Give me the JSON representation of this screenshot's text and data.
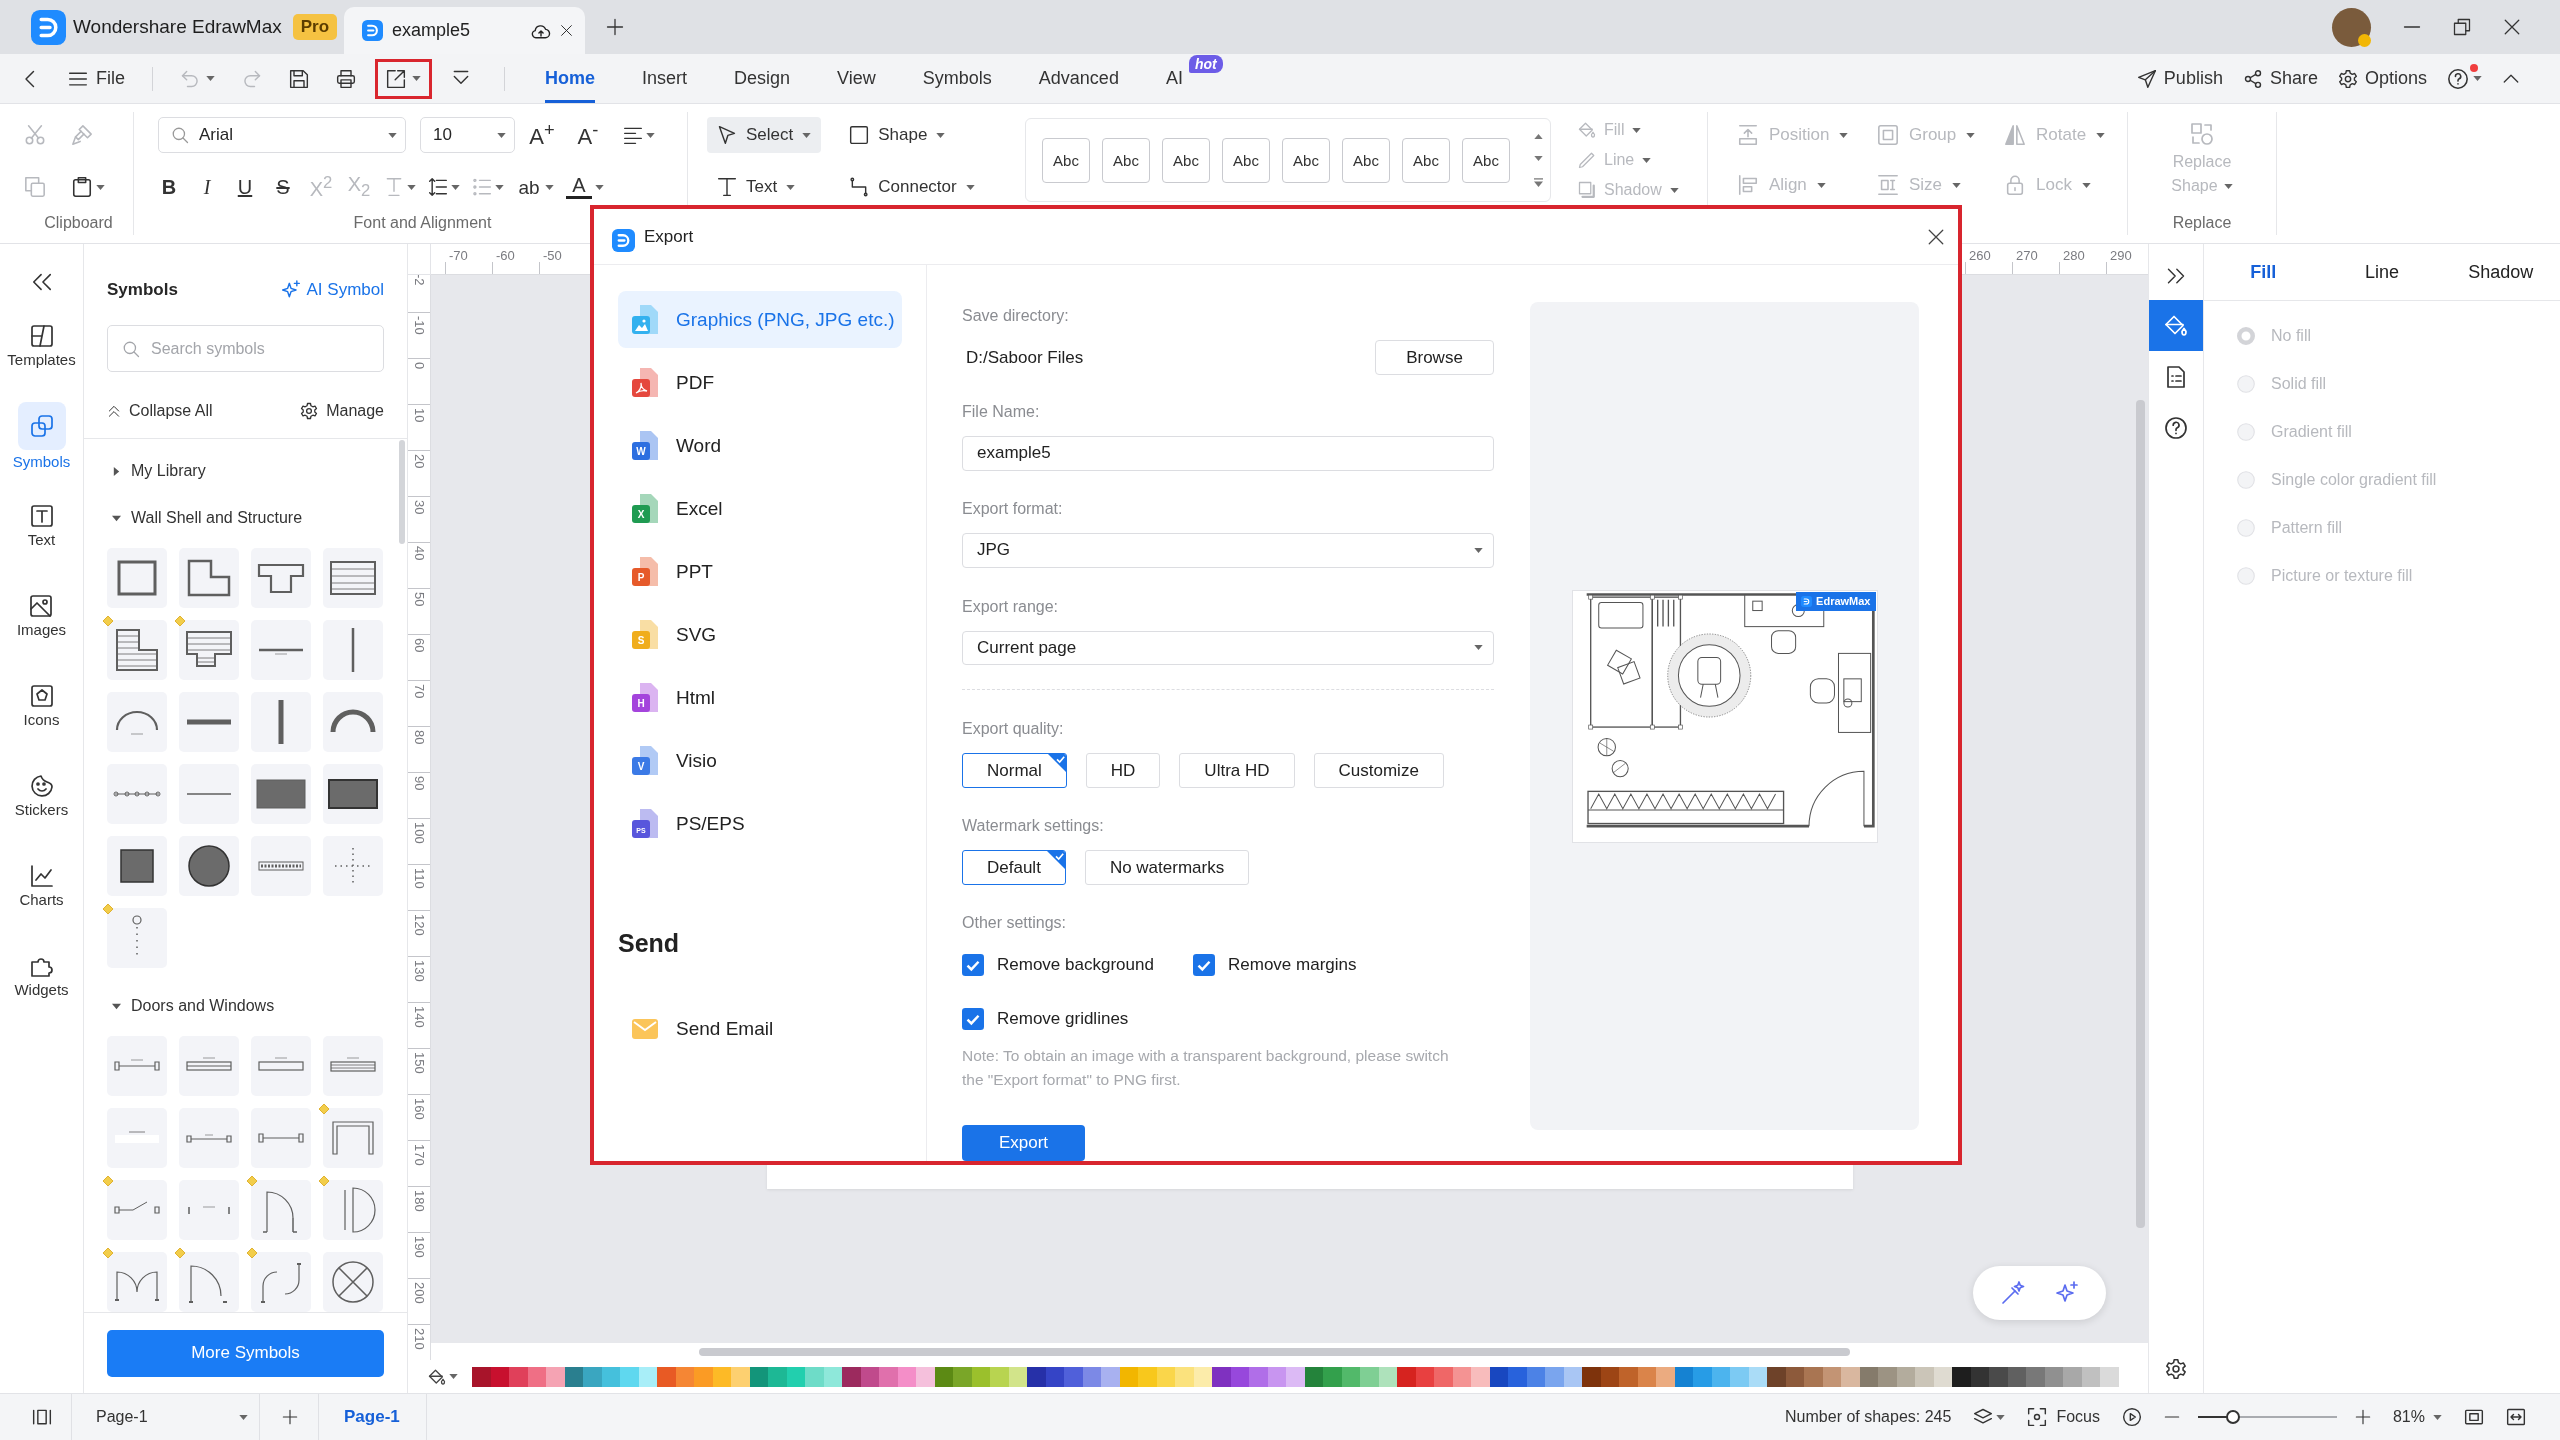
{
  "title_bar": {
    "app_tab": {
      "title": "Wondershare EdrawMax",
      "badge": "Pro"
    },
    "doc_tab": {
      "title": "example5"
    }
  },
  "toolbar": {
    "file": "File",
    "quick_access": [
      {
        "kind": "undo",
        "disabled": true,
        "highlighted": false
      },
      {
        "kind": "redo",
        "disabled": true,
        "highlighted": false
      },
      {
        "kind": "save",
        "disabled": false,
        "highlighted": false
      },
      {
        "kind": "print",
        "disabled": false,
        "highlighted": false
      },
      {
        "kind": "export",
        "disabled": false,
        "highlighted": true
      },
      {
        "kind": "more",
        "disabled": false,
        "highlighted": false
      }
    ],
    "tabs": [
      {
        "label": "Home",
        "selected": true
      },
      {
        "label": "Insert",
        "selected": false
      },
      {
        "label": "Design",
        "selected": false
      },
      {
        "label": "View",
        "selected": false
      },
      {
        "label": "Symbols",
        "selected": false
      },
      {
        "label": "Advanced",
        "selected": false
      },
      {
        "label": "AI",
        "selected": false,
        "badge": "hot"
      }
    ],
    "actions": [
      {
        "kind": "publish",
        "label": "Publish"
      },
      {
        "kind": "share",
        "label": "Share"
      },
      {
        "kind": "options",
        "label": "Options"
      }
    ],
    "help_notice": true
  },
  "ribbon": {
    "clipboard": {
      "label": "Clipboard",
      "buttons": [
        {
          "kind": "cut",
          "disabled": true
        },
        {
          "kind": "format-painter",
          "disabled": true
        },
        {
          "kind": "copy",
          "disabled": true
        },
        {
          "kind": "paste",
          "disabled": false
        }
      ]
    },
    "font": {
      "family": "Arial",
      "size": "10",
      "grow": "A$^{+}$",
      "shrink": "A$^{-}$",
      "buttons": [
        {
          "kind": "bold",
          "glyph": "B",
          "disabled": false
        },
        {
          "kind": "italic",
          "glyph": "I",
          "disabled": false
        },
        {
          "kind": "underline",
          "glyph": "U",
          "disabled": false
        },
        {
          "kind": "strike",
          "glyph": "S",
          "disabled": false
        },
        {
          "kind": "superscript",
          "glyph": "X$^{2}$",
          "disabled": true
        },
        {
          "kind": "subscript",
          "glyph": "X$_{2}$",
          "disabled": true
        },
        {
          "kind": "text-style",
          "disabled": true
        },
        {
          "kind": "line-spacing",
          "disabled": false
        },
        {
          "kind": "bullets",
          "disabled": true
        },
        {
          "kind": "highlight",
          "glyph": "ab",
          "disabled": false
        },
        {
          "kind": "font-color",
          "glyph": "A",
          "disabled": false
        }
      ],
      "label": "Font and Alignment"
    },
    "tools": [
      {
        "kind": "select",
        "label": "Select",
        "selected": true
      },
      {
        "kind": "shape",
        "label": "Shape",
        "selected": false
      },
      {
        "kind": "text",
        "label": "Text",
        "selected": false
      },
      {
        "kind": "connector",
        "label": "Connector",
        "selected": false
      }
    ],
    "styles": [
      "Abc",
      "Abc",
      "Abc",
      "Abc",
      "Abc",
      "Abc",
      "Abc",
      "Abc"
    ],
    "format": [
      {
        "kind": "fill",
        "label": "Fill",
        "disabled": true
      },
      {
        "kind": "line",
        "label": "Line",
        "disabled": true
      },
      {
        "kind": "shadow",
        "label": "Shadow",
        "disabled": true
      }
    ],
    "arrange": [
      {
        "kind": "position",
        "label": "Position",
        "disabled": true
      },
      {
        "kind": "group",
        "label": "Group",
        "disabled": true
      },
      {
        "kind": "rotate",
        "label": "Rotate",
        "disabled": true
      },
      {
        "kind": "align",
        "label": "Align",
        "disabled": true
      },
      {
        "kind": "size",
        "label": "Size",
        "disabled": true
      },
      {
        "kind": "lock",
        "label": "Lock",
        "disabled": true
      }
    ],
    "replace": {
      "button": "Replace Shape",
      "label": "Replace",
      "disabled": true
    }
  },
  "left_rail": [
    {
      "kind": "templates",
      "label": "Templates",
      "selected": false
    },
    {
      "kind": "symbols",
      "label": "Symbols",
      "selected": true
    },
    {
      "kind": "text",
      "label": "Text",
      "selected": false
    },
    {
      "kind": "images",
      "label": "Images",
      "selected": false
    },
    {
      "kind": "icons",
      "label": "Icons",
      "selected": false
    },
    {
      "kind": "stickers",
      "label": "Stickers",
      "selected": false
    },
    {
      "kind": "charts",
      "label": "Charts",
      "selected": false
    },
    {
      "kind": "widgets",
      "label": "Widgets",
      "selected": false
    }
  ],
  "symbols_panel": {
    "title": "Symbols",
    "ai_link": "AI Symbol",
    "search_placeholder": "Search symbols",
    "collapse_all": "Collapse All",
    "manage": "Manage",
    "sections": [
      {
        "title": "My Library",
        "expanded": false
      },
      {
        "title": "Wall Shell and Structure",
        "expanded": true,
        "tiles": [
          {
            "kind": "room-square",
            "premium": false
          },
          {
            "kind": "room-l",
            "premium": false
          },
          {
            "kind": "room-t",
            "premium": false
          },
          {
            "kind": "room-striped",
            "premium": false
          },
          {
            "kind": "room-striped-l",
            "premium": true
          },
          {
            "kind": "room-striped-step",
            "premium": true
          },
          {
            "kind": "wall-thin-h",
            "premium": false
          },
          {
            "kind": "wall-thin-v",
            "premium": false
          },
          {
            "kind": "wall-arc-thin",
            "premium": false
          },
          {
            "kind": "wall-thick-h",
            "premium": false
          },
          {
            "kind": "wall-thick-v",
            "premium": false
          },
          {
            "kind": "wall-arc-thick",
            "premium": false
          },
          {
            "kind": "wall-points",
            "premium": false
          },
          {
            "kind": "wall-line",
            "premium": false
          },
          {
            "kind": "wall-block",
            "premium": false
          },
          {
            "kind": "wall-block-framed",
            "premium": false
          },
          {
            "kind": "column-square",
            "premium": false
          },
          {
            "kind": "column-round",
            "premium": false
          },
          {
            "kind": "wall-hatched",
            "premium": false
          },
          {
            "kind": "wall-cross",
            "premium": false
          },
          {
            "kind": "wall-pin",
            "premium": true
          }
        ]
      },
      {
        "title": "Doors and Windows",
        "expanded": true,
        "tiles": [
          {
            "kind": "window-bracket",
            "premium": false
          },
          {
            "kind": "window-double",
            "premium": false
          },
          {
            "kind": "window-single",
            "premium": false
          },
          {
            "kind": "window-triple",
            "premium": false
          },
          {
            "kind": "window-plain",
            "premium": false
          },
          {
            "kind": "window-small",
            "premium": false
          },
          {
            "kind": "window-bracket-b",
            "premium": false
          },
          {
            "kind": "opening-frame",
            "premium": true
          },
          {
            "kind": "sliding-window",
            "premium": true
          },
          {
            "kind": "window-gap",
            "premium": false
          },
          {
            "kind": "door-single",
            "premium": true
          },
          {
            "kind": "door-round",
            "premium": true
          },
          {
            "kind": "door-double",
            "premium": true
          },
          {
            "kind": "door-single-b",
            "premium": true
          },
          {
            "kind": "door-folding",
            "premium": true
          },
          {
            "kind": "column-cross",
            "premium": false
          }
        ]
      }
    ],
    "more_button": "More Symbols"
  },
  "rulers": {
    "horizontal_start": [
      "-70",
      "-60",
      "-50"
    ],
    "horizontal_end": [
      "260",
      "270",
      "280",
      "290"
    ],
    "vertical": [
      "-2",
      "-10",
      "0",
      "10",
      "20",
      "30",
      "40",
      "50",
      "60",
      "70",
      "80",
      "90",
      "100",
      "110",
      "120",
      "130",
      "140",
      "150",
      "160",
      "170",
      "180",
      "190",
      "200",
      "210"
    ]
  },
  "palette": {
    "swatches": [
      {
        "color": "#a8142a"
      },
      {
        "color": "#c8102e"
      },
      {
        "color": "#e0405a"
      },
      {
        "color": "#ef6f85"
      },
      {
        "color": "#f5a3b3"
      },
      {
        "color": "#2a7f8f"
      },
      {
        "color": "#3aa6c0"
      },
      {
        "color": "#45c0dc"
      },
      {
        "color": "#5fd8ef"
      },
      {
        "color": "#a8eef8"
      },
      {
        "color": "#e85a24"
      },
      {
        "color": "#f58634"
      },
      {
        "color": "#fb9b24"
      },
      {
        "color": "#fdba26"
      },
      {
        "color": "#fdd070"
      },
      {
        "color": "#13957a"
      },
      {
        "color": "#1db895"
      },
      {
        "color": "#22cfae"
      },
      {
        "color": "#6edcc8"
      },
      {
        "color": "#8ee8da"
      },
      {
        "color": "#9c2a5e"
      },
      {
        "color": "#c04a8c"
      },
      {
        "color": "#e070ac"
      },
      {
        "color": "#f48ec8"
      },
      {
        "color": "#f5c0dc"
      },
      {
        "color": "#5c8a14"
      },
      {
        "color": "#7aa628"
      },
      {
        "color": "#9bc02c"
      },
      {
        "color": "#b8d450"
      },
      {
        "color": "#d2e48a"
      },
      {
        "color": "#2630a8"
      },
      {
        "color": "#3544c6"
      },
      {
        "color": "#5060da"
      },
      {
        "color": "#7c89e6"
      },
      {
        "color": "#a8b1f0"
      },
      {
        "color": "#f2b600"
      },
      {
        "color": "#f8c81c"
      },
      {
        "color": "#fad64a"
      },
      {
        "color": "#fbe27d"
      },
      {
        "color": "#fcecaa"
      },
      {
        "color": "#7f31c0"
      },
      {
        "color": "#9748dc"
      },
      {
        "color": "#b06ee8"
      },
      {
        "color": "#c895f0"
      },
      {
        "color": "#dcbaf5"
      },
      {
        "color": "#24833b"
      },
      {
        "color": "#33a04c"
      },
      {
        "color": "#52b96a"
      },
      {
        "color": "#7fcf94"
      },
      {
        "color": "#aee2bb"
      },
      {
        "color": "#d6231f"
      },
      {
        "color": "#e84040"
      },
      {
        "color": "#ef6767"
      },
      {
        "color": "#f49393"
      },
      {
        "color": "#f8bcbc"
      },
      {
        "color": "#1847c0"
      },
      {
        "color": "#2862dc"
      },
      {
        "color": "#4c82e6"
      },
      {
        "color": "#7aa5ee"
      },
      {
        "color": "#a9c6f4"
      },
      {
        "color": "#7e330c"
      },
      {
        "color": "#9d4515"
      },
      {
        "color": "#bf632a"
      },
      {
        "color": "#da844a"
      },
      {
        "color": "#ebab80"
      },
      {
        "color": "#1582d2"
      },
      {
        "color": "#279ce6"
      },
      {
        "color": "#4cb4ee"
      },
      {
        "color": "#7ccaf3"
      },
      {
        "color": "#aadcf7"
      },
      {
        "color": "#6e4229"
      },
      {
        "color": "#8d5a3b"
      },
      {
        "color": "#a97552"
      },
      {
        "color": "#c39474"
      },
      {
        "color": "#d9b79f"
      },
      {
        "color": "#857b6b"
      },
      {
        "color": "#9c9383"
      },
      {
        "color": "#b3ac9d"
      },
      {
        "color": "#cbc5b8"
      },
      {
        "color": "#dfdbd1"
      },
      {
        "color": "#1e1e1e"
      },
      {
        "color": "#333333"
      },
      {
        "color": "#4a4a4a"
      },
      {
        "color": "#606060"
      },
      {
        "color": "#787878"
      },
      {
        "color": "#909090"
      },
      {
        "color": "#a8a8a8"
      },
      {
        "color": "#c0c0c0"
      },
      {
        "color": "#dadada"
      }
    ]
  },
  "format_panel": {
    "rail": [
      {
        "kind": "fill",
        "selected": true
      },
      {
        "kind": "page",
        "selected": false
      },
      {
        "kind": "help",
        "selected": false
      }
    ],
    "tabs": [
      {
        "label": "Fill",
        "selected": true
      },
      {
        "label": "Line",
        "selected": false
      },
      {
        "label": "Shadow",
        "selected": false
      }
    ],
    "fill_options": [
      {
        "label": "No fill",
        "selected": true,
        "disabled": true
      },
      {
        "label": "Solid fill",
        "selected": false,
        "disabled": true
      },
      {
        "label": "Gradient fill",
        "selected": false,
        "disabled": true
      },
      {
        "label": "Single color gradient fill",
        "selected": false,
        "disabled": true
      },
      {
        "label": "Pattern fill",
        "selected": false,
        "disabled": true
      },
      {
        "label": "Picture or texture fill",
        "selected": false,
        "disabled": true
      }
    ]
  },
  "status_bar": {
    "page_select": "Page-1",
    "pages": [
      {
        "label": "Page-1",
        "selected": true
      }
    ],
    "shape_count": "Number of shapes: 245",
    "focus": "Focus",
    "zoom": {
      "level": 0.25,
      "value": "81%"
    }
  },
  "export_dialog": {
    "title": "Export",
    "formats": [
      {
        "kind": "graphics",
        "label": "Graphics (PNG, JPG etc.)",
        "selected": true
      },
      {
        "kind": "pdf",
        "label": "PDF",
        "selected": false
      },
      {
        "kind": "word",
        "label": "Word",
        "icon_text": "W",
        "selected": false
      },
      {
        "kind": "excel",
        "label": "Excel",
        "icon_text": "X",
        "selected": false
      },
      {
        "kind": "ppt",
        "label": "PPT",
        "icon_text": "P",
        "selected": false
      },
      {
        "kind": "svg",
        "label": "SVG",
        "icon_text": "S",
        "selected": false
      },
      {
        "kind": "html",
        "label": "Html",
        "icon_text": "H",
        "selected": false
      },
      {
        "kind": "visio",
        "label": "Visio",
        "icon_text": "V",
        "selected": false
      },
      {
        "kind": "ps",
        "label": "PS/EPS",
        "icon_text": "PS",
        "selected": false
      }
    ],
    "send": {
      "title": "Send",
      "items": [
        {
          "label": "Send Email"
        }
      ]
    },
    "save_directory": {
      "label": "Save directory:",
      "value": "D:/Saboor Files",
      "button": "Browse"
    },
    "file_name": {
      "label": "File Name:",
      "value": "example5"
    },
    "export_format": {
      "label": "Export format:",
      "value": "JPG"
    },
    "export_range": {
      "label": "Export range:",
      "value": "Current page"
    },
    "quality": {
      "label": "Export quality:",
      "options": [
        {
          "label": "Normal",
          "selected": true
        },
        {
          "label": "HD",
          "selected": false
        },
        {
          "label": "Ultra HD",
          "selected": false
        },
        {
          "label": "Customize",
          "selected": false
        }
      ]
    },
    "watermark": {
      "label": "Watermark settings:",
      "options": [
        {
          "label": "Default",
          "selected": true
        },
        {
          "label": "No watermarks",
          "selected": false
        }
      ]
    },
    "other": {
      "label": "Other settings:",
      "options": [
        {
          "label": "Remove background",
          "checked": true
        },
        {
          "label": "Remove margins",
          "checked": true
        },
        {
          "label": "Remove gridlines",
          "checked": true
        }
      ],
      "note": "Note: To obtain an image with a transparent background, please switch the \"Export format\" to PNG first."
    },
    "export_button": "Export",
    "preview": {
      "badge": "EdrawMax"
    }
  }
}
